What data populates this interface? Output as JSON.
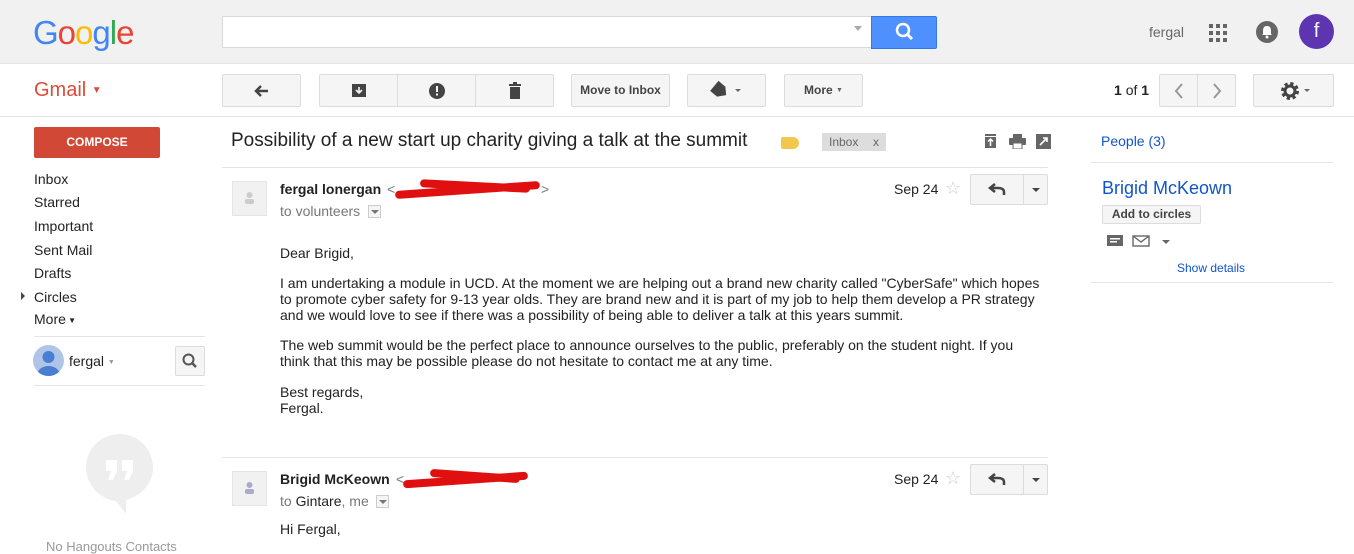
{
  "header": {
    "logo": "Google",
    "user_name": "fergal",
    "avatar_initial": "f"
  },
  "toolbar": {
    "gmail_label": "Gmail",
    "move_to_inbox": "Move to Inbox",
    "more": "More",
    "pager_current": "1",
    "pager_of": "of",
    "pager_total": "1"
  },
  "sidebar": {
    "compose": "COMPOSE",
    "items": [
      "Inbox",
      "Starred",
      "Important",
      "Sent Mail",
      "Drafts",
      "Circles",
      "More"
    ],
    "hangouts_user": "fergal",
    "no_contacts": "No Hangouts Contacts"
  },
  "thread": {
    "subject": "Possibility of a new start up charity giving a talk at the summit",
    "label": "Inbox",
    "label_remove": "x",
    "messages": [
      {
        "sender": "fergal lonergan",
        "to_prefix": "to",
        "to": "volunteers",
        "date": "Sep 24",
        "body": [
          "Dear Brigid,",
          "I am undertaking a module in UCD. At the moment we are helping out a brand new charity called \"CyberSafe\" which hopes to promote cyber safety for 9-13 year olds. They are brand new and it is part of my job to help them develop a PR strategy and we would love to see if there was a possibility of being able to deliver a talk at this years summit.",
          "The web summit would be the perfect place to announce ourselves to the public, preferably on the student night. If you think that this may be possible please do not hesitate to contact me at any time.",
          "Best regards,",
          "Fergal."
        ]
      },
      {
        "sender": "Brigid McKeown",
        "to_prefix": "to",
        "to_name": "Gintare",
        "to_rest": ", me",
        "date": "Sep 24",
        "body": [
          "Hi Fergal,"
        ]
      }
    ]
  },
  "people": {
    "title": "People (3)",
    "contact_name": "Brigid McKeown",
    "add_to_circles": "Add to circles",
    "show_details": "Show details"
  },
  "colors": {
    "accent": "#dd4b39",
    "search_blue": "#4d90fe",
    "link": "#1155cc",
    "avatar": "#5e35b1"
  }
}
